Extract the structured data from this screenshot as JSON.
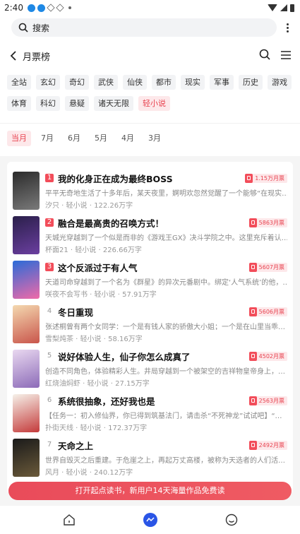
{
  "status": {
    "time": "2:40"
  },
  "search": {
    "placeholder": "搜索"
  },
  "header": {
    "title": "月票榜"
  },
  "categories": {
    "row1": [
      "全站",
      "玄幻",
      "奇幻",
      "武侠",
      "仙侠",
      "都市",
      "现实",
      "军事",
      "历史",
      "游戏"
    ],
    "row2": [
      "体育",
      "科幻",
      "悬疑",
      "诸天无限",
      "轻小说"
    ],
    "active": "轻小说"
  },
  "months": [
    "当月",
    "7月",
    "6月",
    "5月",
    "4月",
    "3月"
  ],
  "active_month": "当月",
  "books": [
    {
      "rank": "1",
      "title": "我的化身正在成为最终BOSS",
      "tickets": "1.15万月票",
      "desc": "平平无奇地生活了十多年后，某天夜里，婀明欢忽然觉醒了一个能够“在现实…",
      "author": "汐只",
      "category": "轻小说",
      "words": "122.26万字"
    },
    {
      "rank": "2",
      "title": "融合是最高贵的召唤方式！",
      "tickets": "5863月票",
      "desc": "天城光穿越到了一个似是而非的《游戏王GX》决斗学院之中。这里充斥着认…",
      "author": "杯面21",
      "category": "轻小说",
      "words": "226.66万字"
    },
    {
      "rank": "3",
      "title": "这个反派过于有人气",
      "tickets": "5607月票",
      "desc": "天道司命穿越到了一个名为《群星》的异次元番剧中。绑定‘人气系统’的他，…",
      "author": "咲夜不会写书",
      "category": "轻小说",
      "words": "57.91万字"
    },
    {
      "rank": "4",
      "title": "冬日重现",
      "tickets": "5606月票",
      "desc": "张述桐曾有两个女同学：一个是有钱人家的骄傲大小姐；一个是在山里当乖…",
      "author": "雪梨炖茶",
      "category": "轻小说",
      "words": "58.16万字"
    },
    {
      "rank": "5",
      "title": "说好体验人生，仙子你怎么成真了",
      "tickets": "4502月票",
      "desc": "创造不同角色，体验精彩人生。井局穿越到一个被架空的吉祥物皇帝身上，…",
      "author": "红烧油焖虾",
      "category": "轻小说",
      "words": "27.15万字"
    },
    {
      "rank": "6",
      "title": "系统很抽象，还好我也是",
      "tickets": "2563月票",
      "desc": "【任务一：初入修仙界，你已得到筑基法门，请击杀“不死神龙”试试吧】“…",
      "author": "扑街天线",
      "category": "轻小说",
      "words": "172.37万字"
    },
    {
      "rank": "7",
      "title": "天命之上",
      "tickets": "2492月票",
      "desc": "世界自毁灭之后重建。于危崖之上，再起万丈高楼，被称为天选者的人们活…",
      "author": "风月",
      "category": "轻小说",
      "words": "240.12万字"
    }
  ],
  "cta": {
    "label": "打开起点读书，新用户14天海量作品免费读"
  },
  "colors": {
    "accent": "#e8424f",
    "tab_active": "#2a55e6"
  }
}
